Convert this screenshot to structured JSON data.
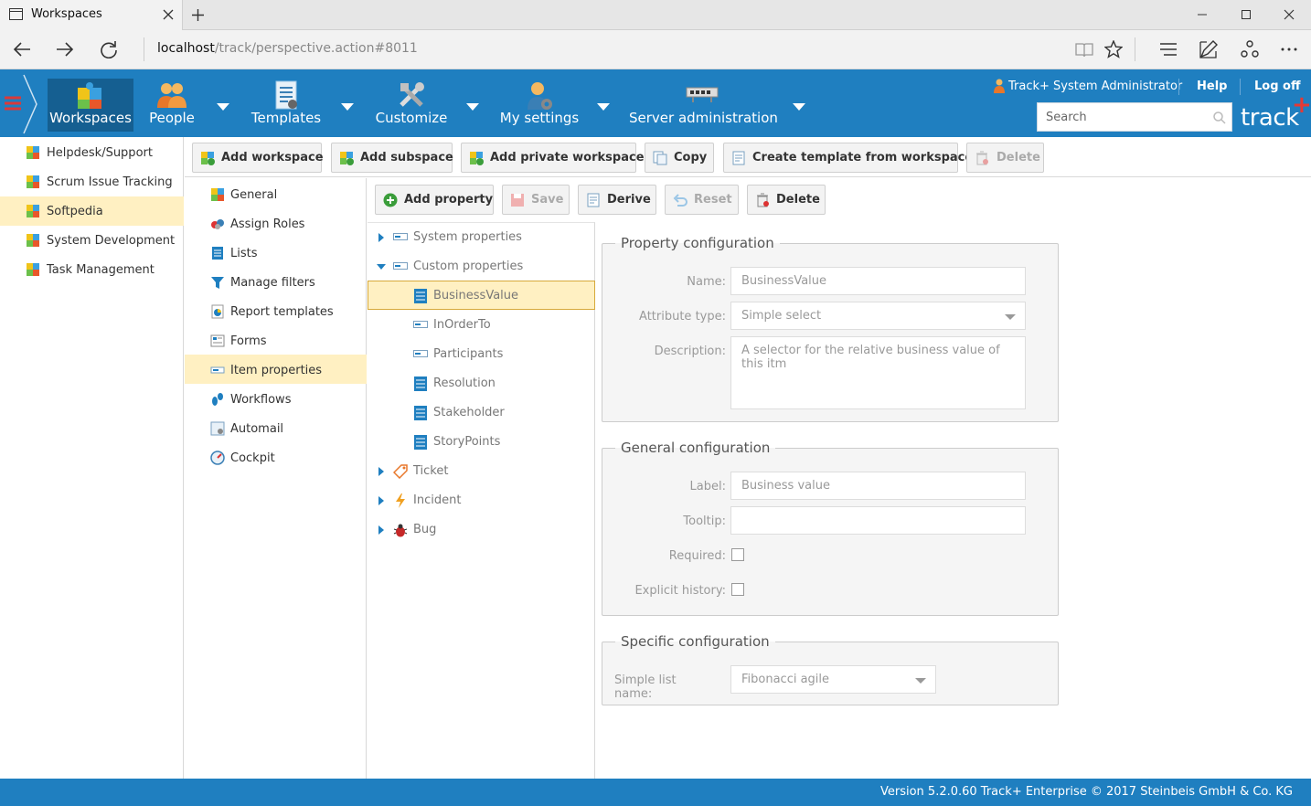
{
  "browser": {
    "tab_title": "Workspaces",
    "url_host": "localhost",
    "url_path": "/track/perspective.action#8011"
  },
  "header": {
    "nav": [
      {
        "label": "Workspaces",
        "icon": "puzzle-icon"
      },
      {
        "label": "People",
        "icon": "people-icon"
      },
      {
        "label": "Templates",
        "icon": "document-icon"
      },
      {
        "label": "Customize",
        "icon": "tools-icon"
      },
      {
        "label": "My settings",
        "icon": "user-gear-icon"
      },
      {
        "label": "Server administration",
        "icon": "server-icon"
      }
    ],
    "user": "Track+ System Administrator",
    "help": "Help",
    "logoff": "Log off",
    "search_placeholder": "Search",
    "logo": "track",
    "logo_plus": "+",
    "accent": "#1f7fc0"
  },
  "workspaces": [
    "Helpdesk/Support",
    "Scrum Issue Tracking",
    "Softpedia",
    "System Development",
    "Task Management"
  ],
  "workspace_selected": "Softpedia",
  "toolbar": {
    "add_workspace": "Add workspace",
    "add_subspace": "Add subspace",
    "add_private": "Add private workspace",
    "copy": "Copy",
    "create_template": "Create template from workspace",
    "delete": "Delete"
  },
  "config_menu": [
    "General",
    "Assign Roles",
    "Lists",
    "Manage filters",
    "Report templates",
    "Forms",
    "Item properties",
    "Workflows",
    "Automail",
    "Cockpit"
  ],
  "config_selected": "Item properties",
  "prop_toolbar": {
    "add_property": "Add property",
    "save": "Save",
    "derive": "Derive",
    "reset": "Reset",
    "delete": "Delete"
  },
  "tree": {
    "system": "System properties",
    "custom": "Custom properties",
    "children": [
      "BusinessValue",
      "InOrderTo",
      "Participants",
      "Resolution",
      "Stakeholder",
      "StoryPoints"
    ],
    "ticket": "Ticket",
    "incident": "Incident",
    "bug": "Bug"
  },
  "property_config": {
    "legend": "Property configuration",
    "name_label": "Name:",
    "name_value": "BusinessValue",
    "type_label": "Attribute type:",
    "type_value": "Simple select",
    "desc_label": "Description:",
    "desc_value": "A selector for the relative business value of this itm"
  },
  "general_config": {
    "legend": "General configuration",
    "label_label": "Label:",
    "label_value": "Business value",
    "tooltip_label": "Tooltip:",
    "tooltip_value": "",
    "required_label": "Required:",
    "required": false,
    "history_label": "Explicit history:",
    "history": false
  },
  "specific_config": {
    "legend": "Specific configuration",
    "list_label": "Simple list name:",
    "list_value": "Fibonacci agile"
  },
  "status": "Version 5.2.0.60 Track+ Enterprise   © 2017 Steinbeis GmbH & Co. KG"
}
